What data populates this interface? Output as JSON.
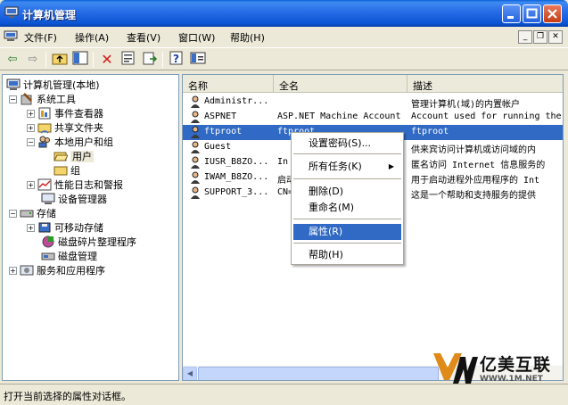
{
  "window": {
    "title": "计算机管理"
  },
  "menubar": {
    "items": [
      "文件(F)",
      "操作(A)",
      "查看(V)",
      "窗口(W)",
      "帮助(H)"
    ]
  },
  "toolbar": {
    "buttons": [
      "back-icon",
      "forward-icon",
      "up-folder-icon",
      "show-tree-icon",
      "delete-icon",
      "properties-icon",
      "export-icon",
      "help-icon",
      "console-icon"
    ]
  },
  "tree": {
    "items": [
      {
        "label": "计算机管理(本地)",
        "icon": "computer-icon",
        "expander": ""
      },
      {
        "label": "系统工具",
        "icon": "tools-icon",
        "expander": "−"
      },
      {
        "label": "事件查看器",
        "icon": "event-viewer-icon",
        "expander": "+"
      },
      {
        "label": "共享文件夹",
        "icon": "shared-folder-icon",
        "expander": "+"
      },
      {
        "label": "本地用户和组",
        "icon": "users-groups-icon",
        "expander": "−"
      },
      {
        "label": "用户",
        "icon": "folder-open-icon",
        "expander": ""
      },
      {
        "label": "组",
        "icon": "folder-icon",
        "expander": ""
      },
      {
        "label": "性能日志和警报",
        "icon": "performance-icon",
        "expander": "+"
      },
      {
        "label": "设备管理器",
        "icon": "device-manager-icon",
        "expander": ""
      },
      {
        "label": "存储",
        "icon": "storage-icon",
        "expander": "−"
      },
      {
        "label": "可移动存储",
        "icon": "removable-storage-icon",
        "expander": "+"
      },
      {
        "label": "磁盘碎片整理程序",
        "icon": "defrag-icon",
        "expander": ""
      },
      {
        "label": "磁盘管理",
        "icon": "disk-management-icon",
        "expander": ""
      },
      {
        "label": "服务和应用程序",
        "icon": "services-icon",
        "expander": "+"
      }
    ]
  },
  "list": {
    "columns": [
      "名称",
      "全名",
      "描述"
    ],
    "rows": [
      {
        "name": "Administr...",
        "fullname": "",
        "desc": "管理计算机(域)的内置帐户"
      },
      {
        "name": "ASPNET",
        "fullname": "ASP.NET Machine Account",
        "desc": "Account used for running the"
      },
      {
        "name": "ftproot",
        "fullname": "ftproot",
        "desc": "ftproot"
      },
      {
        "name": "Guest",
        "fullname": "",
        "desc": "供来宾访问计算机或访问域的内"
      },
      {
        "name": "IUSR_B8ZO...",
        "fullname": "In",
        "desc": "匿名访问 Internet 信息服务的"
      },
      {
        "name": "IWAM_B8ZO...",
        "fullname": "启动",
        "desc": "用于启动进程外应用程序的 Int"
      },
      {
        "name": "SUPPORT_3...",
        "fullname": "CN=",
        "desc": "这是一个帮助和支持服务的提供"
      }
    ]
  },
  "context_menu": {
    "items": [
      "设置密码(S)...",
      "所有任务(K)",
      "删除(D)",
      "重命名(M)",
      "属性(R)",
      "帮助(H)"
    ]
  },
  "status": {
    "text": "打开当前选择的属性对话框。"
  },
  "watermark": {
    "brand": "亿美互联",
    "url": "WWW.1M.NET"
  },
  "colors": {
    "title_blue": "#0a54d4",
    "selection": "#316ac5",
    "chrome": "#ece9d8"
  }
}
